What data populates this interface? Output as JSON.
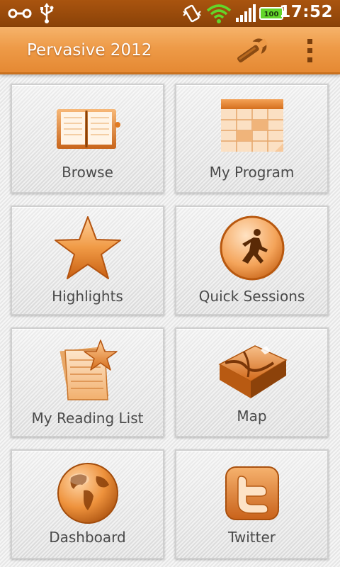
{
  "status_bar": {
    "time": "17:52",
    "battery_level": "100",
    "icons": [
      "link-icon",
      "usb-icon",
      "vibrate-icon",
      "wifi-icon",
      "signal-icon",
      "battery-icon"
    ]
  },
  "action_bar": {
    "title": "Pervasive 2012",
    "actions": [
      "wrench-icon",
      "overflow-menu-icon"
    ]
  },
  "theme": {
    "accent": "#ee9b48",
    "status_bar": "#9a4a0c",
    "icon_orange": "#e07a22",
    "tile_bg": "#e8e8e8",
    "label_color": "#4a4a4a"
  },
  "tiles": [
    {
      "label": "Browse",
      "icon": "book-icon"
    },
    {
      "label": "My Program",
      "icon": "calendar-icon"
    },
    {
      "label": "Highlights",
      "icon": "star-icon"
    },
    {
      "label": "Quick Sessions",
      "icon": "runner-icon"
    },
    {
      "label": "My Reading List",
      "icon": "reading-list-icon"
    },
    {
      "label": "Map",
      "icon": "map-icon"
    },
    {
      "label": "Dashboard",
      "icon": "globe-icon"
    },
    {
      "label": "Twitter",
      "icon": "twitter-icon"
    }
  ]
}
